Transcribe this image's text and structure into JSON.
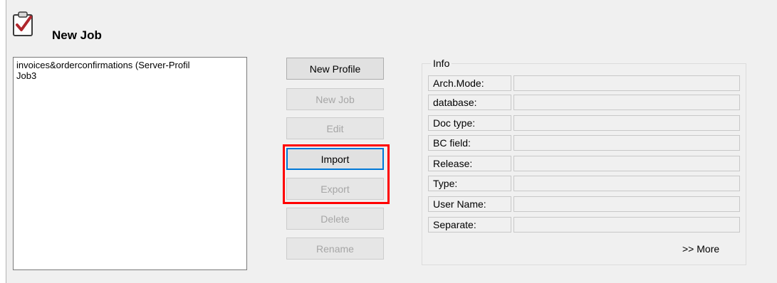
{
  "title": "New Job",
  "job_list": [
    "invoices&orderconfirmations (Server-Profil",
    "Job3"
  ],
  "buttons": {
    "new_profile": "New Profile",
    "new_job": "New Job",
    "edit": "Edit",
    "import": "Import",
    "export": "Export",
    "delete": "Delete",
    "rename": "Rename"
  },
  "info": {
    "group_label": "Info",
    "fields": [
      {
        "label": "Arch.Mode:",
        "value": ""
      },
      {
        "label": "database:",
        "value": ""
      },
      {
        "label": "Doc type:",
        "value": ""
      },
      {
        "label": "BC field:",
        "value": ""
      },
      {
        "label": "Release:",
        "value": ""
      },
      {
        "label": "Type:",
        "value": ""
      },
      {
        "label": "User Name:",
        "value": ""
      },
      {
        "label": "Separate:",
        "value": ""
      }
    ],
    "more_label": ">> More"
  },
  "colors": {
    "highlight": "#ff0000",
    "focus": "#0078d7",
    "checkmark": "#b0282e"
  }
}
